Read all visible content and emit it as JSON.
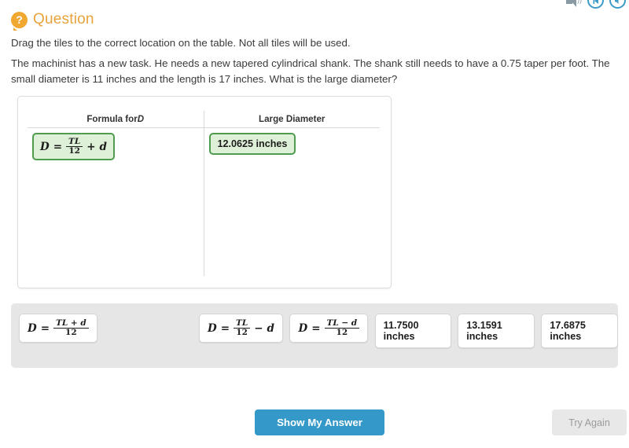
{
  "header": {
    "question_label": "Question",
    "question_icon": "question-bubble-icon",
    "accent_color": "#e8a33d"
  },
  "audio_bar": {
    "speaker_icon": "speaker-icon",
    "replay_icon": "replay-audio-icon",
    "volume_icon": "volume-icon"
  },
  "instruction": "Drag the tiles to the correct location on the table. Not all tiles will be used.",
  "prompt": "The machinist has a new task. He needs a new tapered cylindrical shank. The shank still needs to have a  0.75 taper per foot. The small diameter is 11 inches and the length is 17 inches. What is the large diameter?",
  "table": {
    "columns": [
      {
        "label_prefix": "Formula for ",
        "label_italic": "D"
      },
      {
        "label_prefix": "Large Diameter",
        "label_italic": ""
      }
    ],
    "placed": {
      "formula": {
        "lhs": "D",
        "eq": "=",
        "num": "TL",
        "den": "12",
        "op": "+",
        "rhs": "d"
      },
      "value": "12.0625 inches"
    }
  },
  "tray": {
    "tiles": [
      {
        "kind": "formula",
        "lhs": "D",
        "eq": "=",
        "num": "TL + d",
        "den": "12",
        "op": "",
        "rhs": ""
      },
      {
        "kind": "formula",
        "lhs": "D",
        "eq": "=",
        "num": "TL",
        "den": "12",
        "op": "−",
        "rhs": "d"
      },
      {
        "kind": "formula",
        "lhs": "D",
        "eq": "=",
        "num": "TL − d",
        "den": "12",
        "op": "",
        "rhs": ""
      },
      {
        "kind": "text",
        "value": "11.7500 inches"
      },
      {
        "kind": "text",
        "value": "13.1591 inches"
      },
      {
        "kind": "text",
        "value": "17.6875 inches"
      }
    ]
  },
  "footer": {
    "show_answer_label": "Show My Answer",
    "try_again_label": "Try Again",
    "primary_color": "#3498c8",
    "disabled_color": "#e8e8e8"
  },
  "colors": {
    "placed_tile_fill": "#dff0d8",
    "placed_tile_border": "#4f9b4f",
    "tray_background": "#e6e6e6"
  }
}
